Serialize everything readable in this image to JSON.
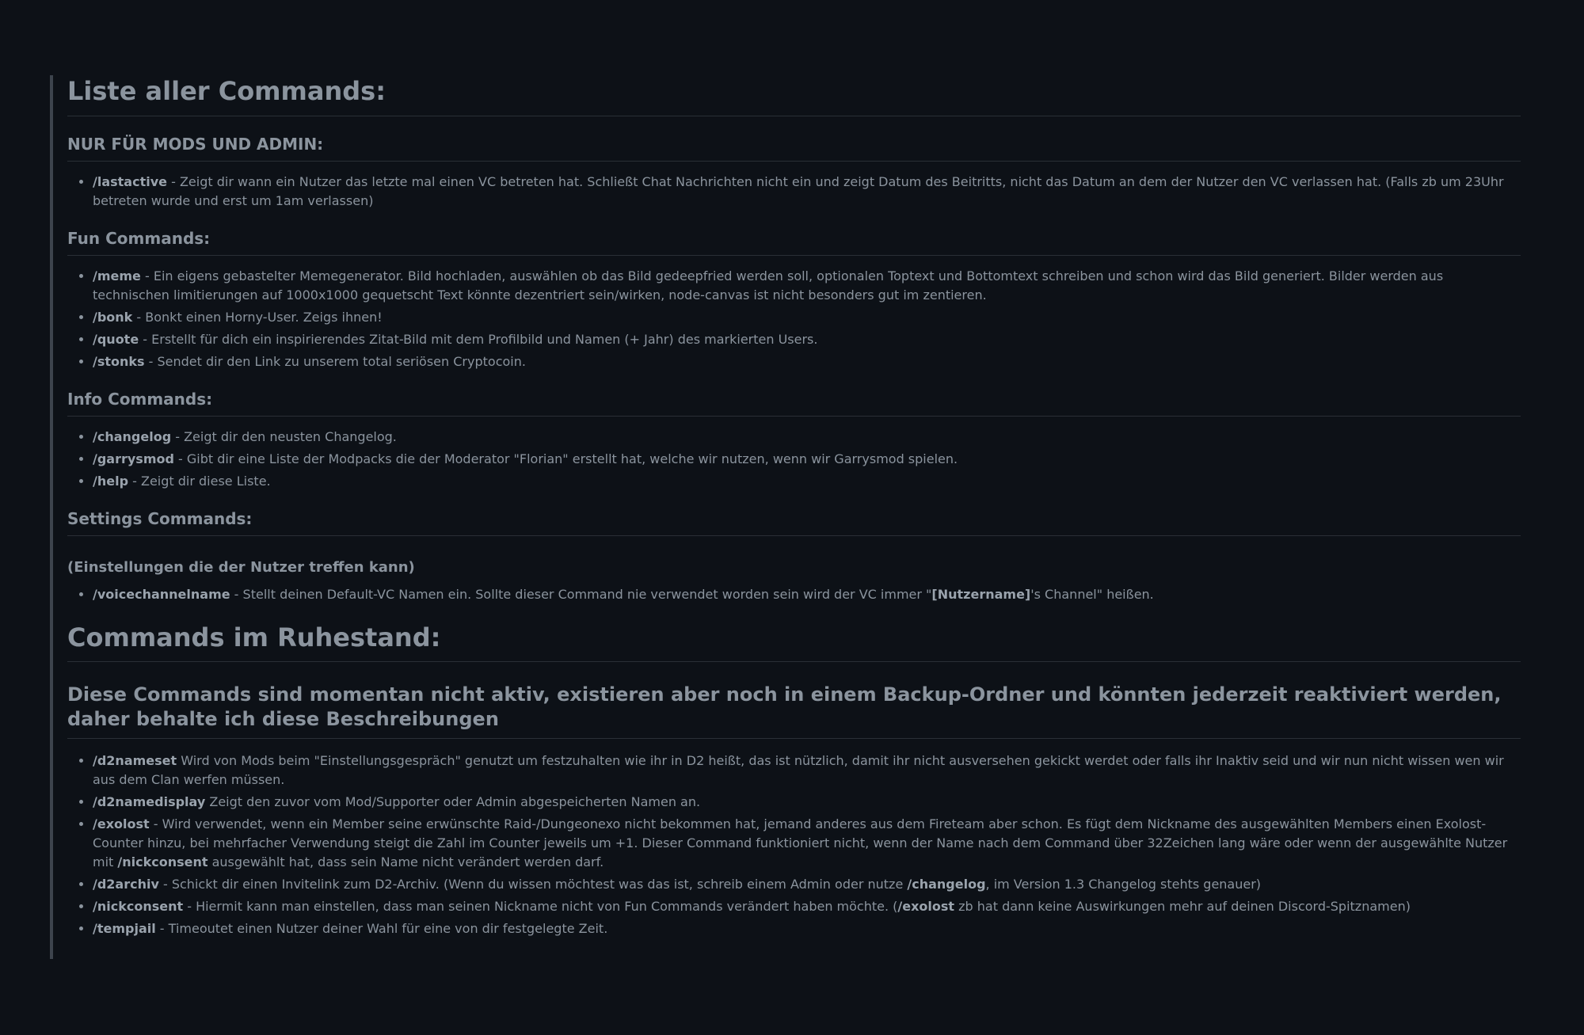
{
  "title": "Liste aller Commands:",
  "mods_section": {
    "heading": "NUR FÜR MODS UND ADMIN:",
    "items": [
      {
        "cmd": "/lastactive",
        "text": " - Zeigt dir wann ein Nutzer das letzte mal einen VC betreten hat. Schließt Chat Nachrichten nicht ein und zeigt Datum des Beitritts, nicht das Datum an dem der Nutzer den VC verlassen hat. (Falls zb um 23Uhr betreten wurde und erst um 1am verlassen)"
      }
    ]
  },
  "fun_section": {
    "heading": "Fun Commands:",
    "items": [
      {
        "cmd": "/meme",
        "text": " - Ein eigens gebastelter Memegenerator. Bild hochladen, auswählen ob das Bild gedeepfried werden soll, optionalen Toptext und Bottomtext schreiben und schon wird das Bild generiert. Bilder werden aus technischen limitierungen auf 1000x1000 gequetscht Text könnte dezentriert sein/wirken, node-canvas ist nicht besonders gut im zentieren."
      },
      {
        "cmd": "/bonk",
        "text": " - Bonkt einen Horny-User. Zeigs ihnen!"
      },
      {
        "cmd": "/quote",
        "text": " - Erstellt für dich ein inspirierendes Zitat-Bild mit dem Profilbild und Namen (+ Jahr) des markierten Users."
      },
      {
        "cmd": "/stonks",
        "text": " - Sendet dir den Link zu unserem total seriösen Cryptocoin."
      }
    ]
  },
  "info_section": {
    "heading": "Info Commands:",
    "items": [
      {
        "cmd": "/changelog",
        "text": " - Zeigt dir den neusten Changelog."
      },
      {
        "cmd": "/garrysmod",
        "text": " - Gibt dir eine Liste der Modpacks die der Moderator \"Florian\" erstellt hat, welche wir nutzen, wenn wir Garrysmod spielen."
      },
      {
        "cmd": "/help",
        "text": " - Zeigt dir diese Liste."
      }
    ]
  },
  "settings_section": {
    "heading": "Settings Commands:",
    "subheading": "(Einstellungen die der Nutzer treffen kann)",
    "items": [
      {
        "cmd": "/voicechannelname",
        "text_before": " - Stellt deinen Default-VC Namen ein. Sollte dieser Command nie verwendet worden sein wird der VC immer \"",
        "bold": "[Nutzername]",
        "text_after": "'s Channel\" heißen."
      }
    ]
  },
  "retired_section": {
    "heading": "Commands im Ruhestand:",
    "subheading": "Diese Commands sind momentan nicht aktiv, existieren aber noch in einem Backup-Ordner und könnten jederzeit reaktiviert werden, daher behalte ich diese Beschreibungen",
    "items": [
      {
        "cmd": "/d2nameset",
        "text": " Wird von Mods beim \"Einstellungsgespräch\" genutzt um festzuhalten wie ihr in D2 heißt, das ist nützlich, damit ihr nicht ausversehen gekickt werdet oder falls ihr Inaktiv seid und wir nun nicht wissen wen wir aus dem Clan werfen müssen."
      },
      {
        "cmd": "/d2namedisplay",
        "text": " Zeigt den zuvor vom Mod/Supporter oder Admin abgespeicherten Namen an."
      },
      {
        "cmd": "/exolost",
        "text_before": " - Wird verwendet, wenn ein Member seine erwünschte Raid-/Dungeonexo nicht bekommen hat, jemand anderes aus dem Fireteam aber schon. Es fügt dem Nickname des ausgewählten Members einen Exolost-Counter hinzu, bei mehrfacher Verwendung steigt die Zahl im Counter jeweils um +1. Dieser Command funktioniert nicht, wenn der Name nach dem Command über 32Zeichen lang wäre oder wenn der ausgewählte Nutzer mit ",
        "bold": "/nickconsent",
        "text_after": " ausgewählt hat, dass sein Name nicht verändert werden darf."
      },
      {
        "cmd": "/d2archiv",
        "text_before": " - Schickt dir einen Invitelink zum D2-Archiv. (Wenn du wissen möchtest was das ist, schreib einem Admin oder nutze ",
        "bold": "/changelog",
        "text_after": ", im Version 1.3 Changelog stehts genauer)"
      },
      {
        "cmd": "/nickconsent",
        "text_before": " - Hiermit kann man einstellen, dass man seinen Nickname nicht von Fun Commands verändert haben möchte. (",
        "bold": "/exolost",
        "text_after": " zb hat dann keine Auswirkungen mehr auf deinen Discord-Spitznamen)"
      },
      {
        "cmd": "/tempjail",
        "text": " - Timeoutet einen Nutzer deiner Wahl für eine von dir festgelegte Zeit."
      }
    ]
  }
}
